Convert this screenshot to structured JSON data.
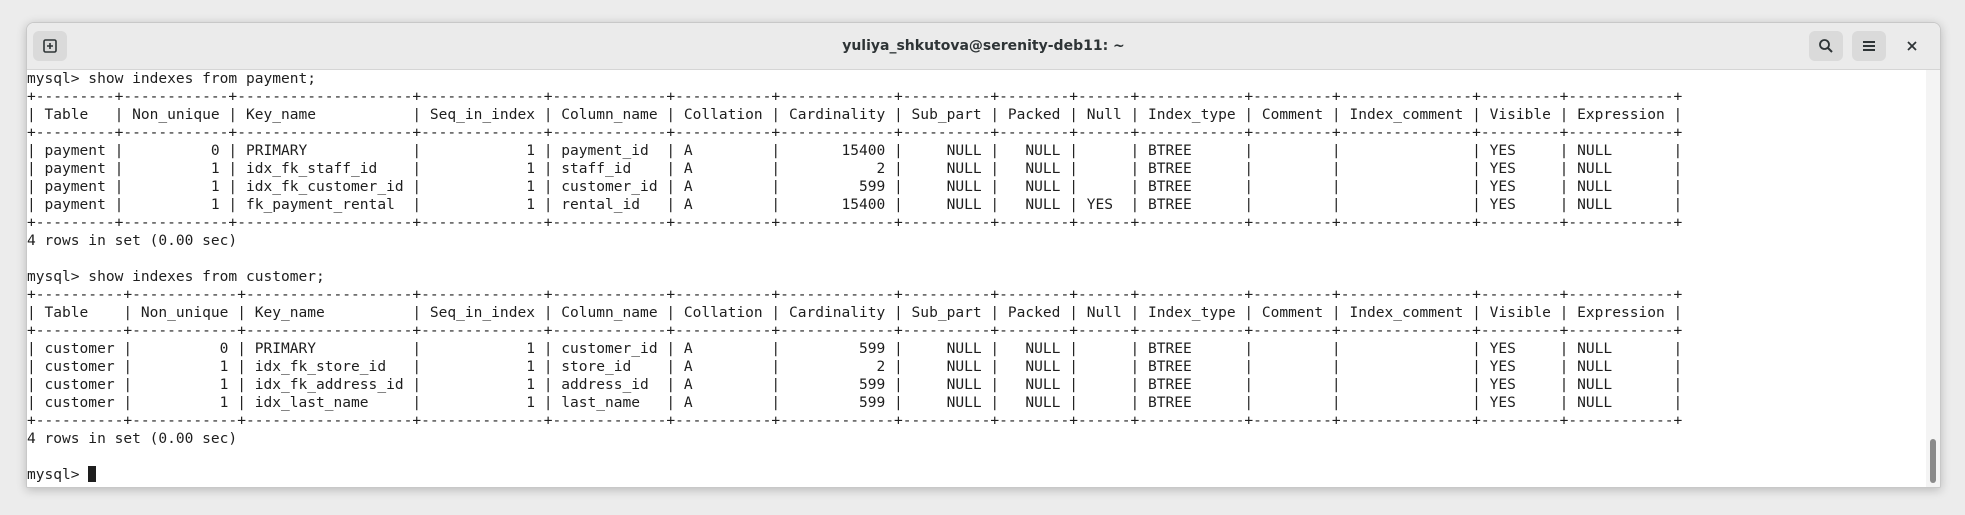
{
  "window": {
    "title": "yuliya_shkutova@serenity-deb11: ~",
    "buttons": {
      "new_tab_icon": "new-tab-icon",
      "search_icon": "search-icon",
      "menu_icon": "hamburger-menu-icon",
      "close_icon": "close-icon"
    }
  },
  "terminal": {
    "lines": [
      "mysql> show indexes from payment;",
      "+---------+------------+--------------------+--------------+-------------+-----------+-------------+----------+--------+------+------------+---------+---------------+---------+------------+",
      "| Table   | Non_unique | Key_name           | Seq_in_index | Column_name | Collation | Cardinality | Sub_part | Packed | Null | Index_type | Comment | Index_comment | Visible | Expression |",
      "+---------+------------+--------------------+--------------+-------------+-----------+-------------+----------+--------+------+------------+---------+---------------+---------+------------+",
      "| payment |          0 | PRIMARY            |            1 | payment_id  | A         |       15400 |     NULL |   NULL |      | BTREE      |         |               | YES     | NULL       |",
      "| payment |          1 | idx_fk_staff_id    |            1 | staff_id    | A         |           2 |     NULL |   NULL |      | BTREE      |         |               | YES     | NULL       |",
      "| payment |          1 | idx_fk_customer_id |            1 | customer_id | A         |         599 |     NULL |   NULL |      | BTREE      |         |               | YES     | NULL       |",
      "| payment |          1 | fk_payment_rental  |            1 | rental_id   | A         |       15400 |     NULL |   NULL | YES  | BTREE      |         |               | YES     | NULL       |",
      "+---------+------------+--------------------+--------------+-------------+-----------+-------------+----------+--------+------+------------+---------+---------------+---------+------------+",
      "4 rows in set (0.00 sec)",
      "",
      "mysql> show indexes from customer;",
      "+----------+------------+-------------------+--------------+-------------+-----------+-------------+----------+--------+------+------------+---------+---------------+---------+------------+",
      "| Table    | Non_unique | Key_name          | Seq_in_index | Column_name | Collation | Cardinality | Sub_part | Packed | Null | Index_type | Comment | Index_comment | Visible | Expression |",
      "+----------+------------+-------------------+--------------+-------------+-----------+-------------+----------+--------+------+------------+---------+---------------+---------+------------+",
      "| customer |          0 | PRIMARY           |            1 | customer_id | A         |         599 |     NULL |   NULL |      | BTREE      |         |               | YES     | NULL       |",
      "| customer |          1 | idx_fk_store_id   |            1 | store_id    | A         |           2 |     NULL |   NULL |      | BTREE      |         |               | YES     | NULL       |",
      "| customer |          1 | idx_fk_address_id |            1 | address_id  | A         |         599 |     NULL |   NULL |      | BTREE      |         |               | YES     | NULL       |",
      "| customer |          1 | idx_last_name     |            1 | last_name   | A         |         599 |     NULL |   NULL |      | BTREE      |         |               | YES     | NULL       |",
      "+----------+------------+-------------------+--------------+-------------+-----------+-------------+----------+--------+------+------------+---------+---------------+---------+------------+",
      "4 rows in set (0.00 sec)",
      ""
    ],
    "prompt": "mysql> "
  }
}
